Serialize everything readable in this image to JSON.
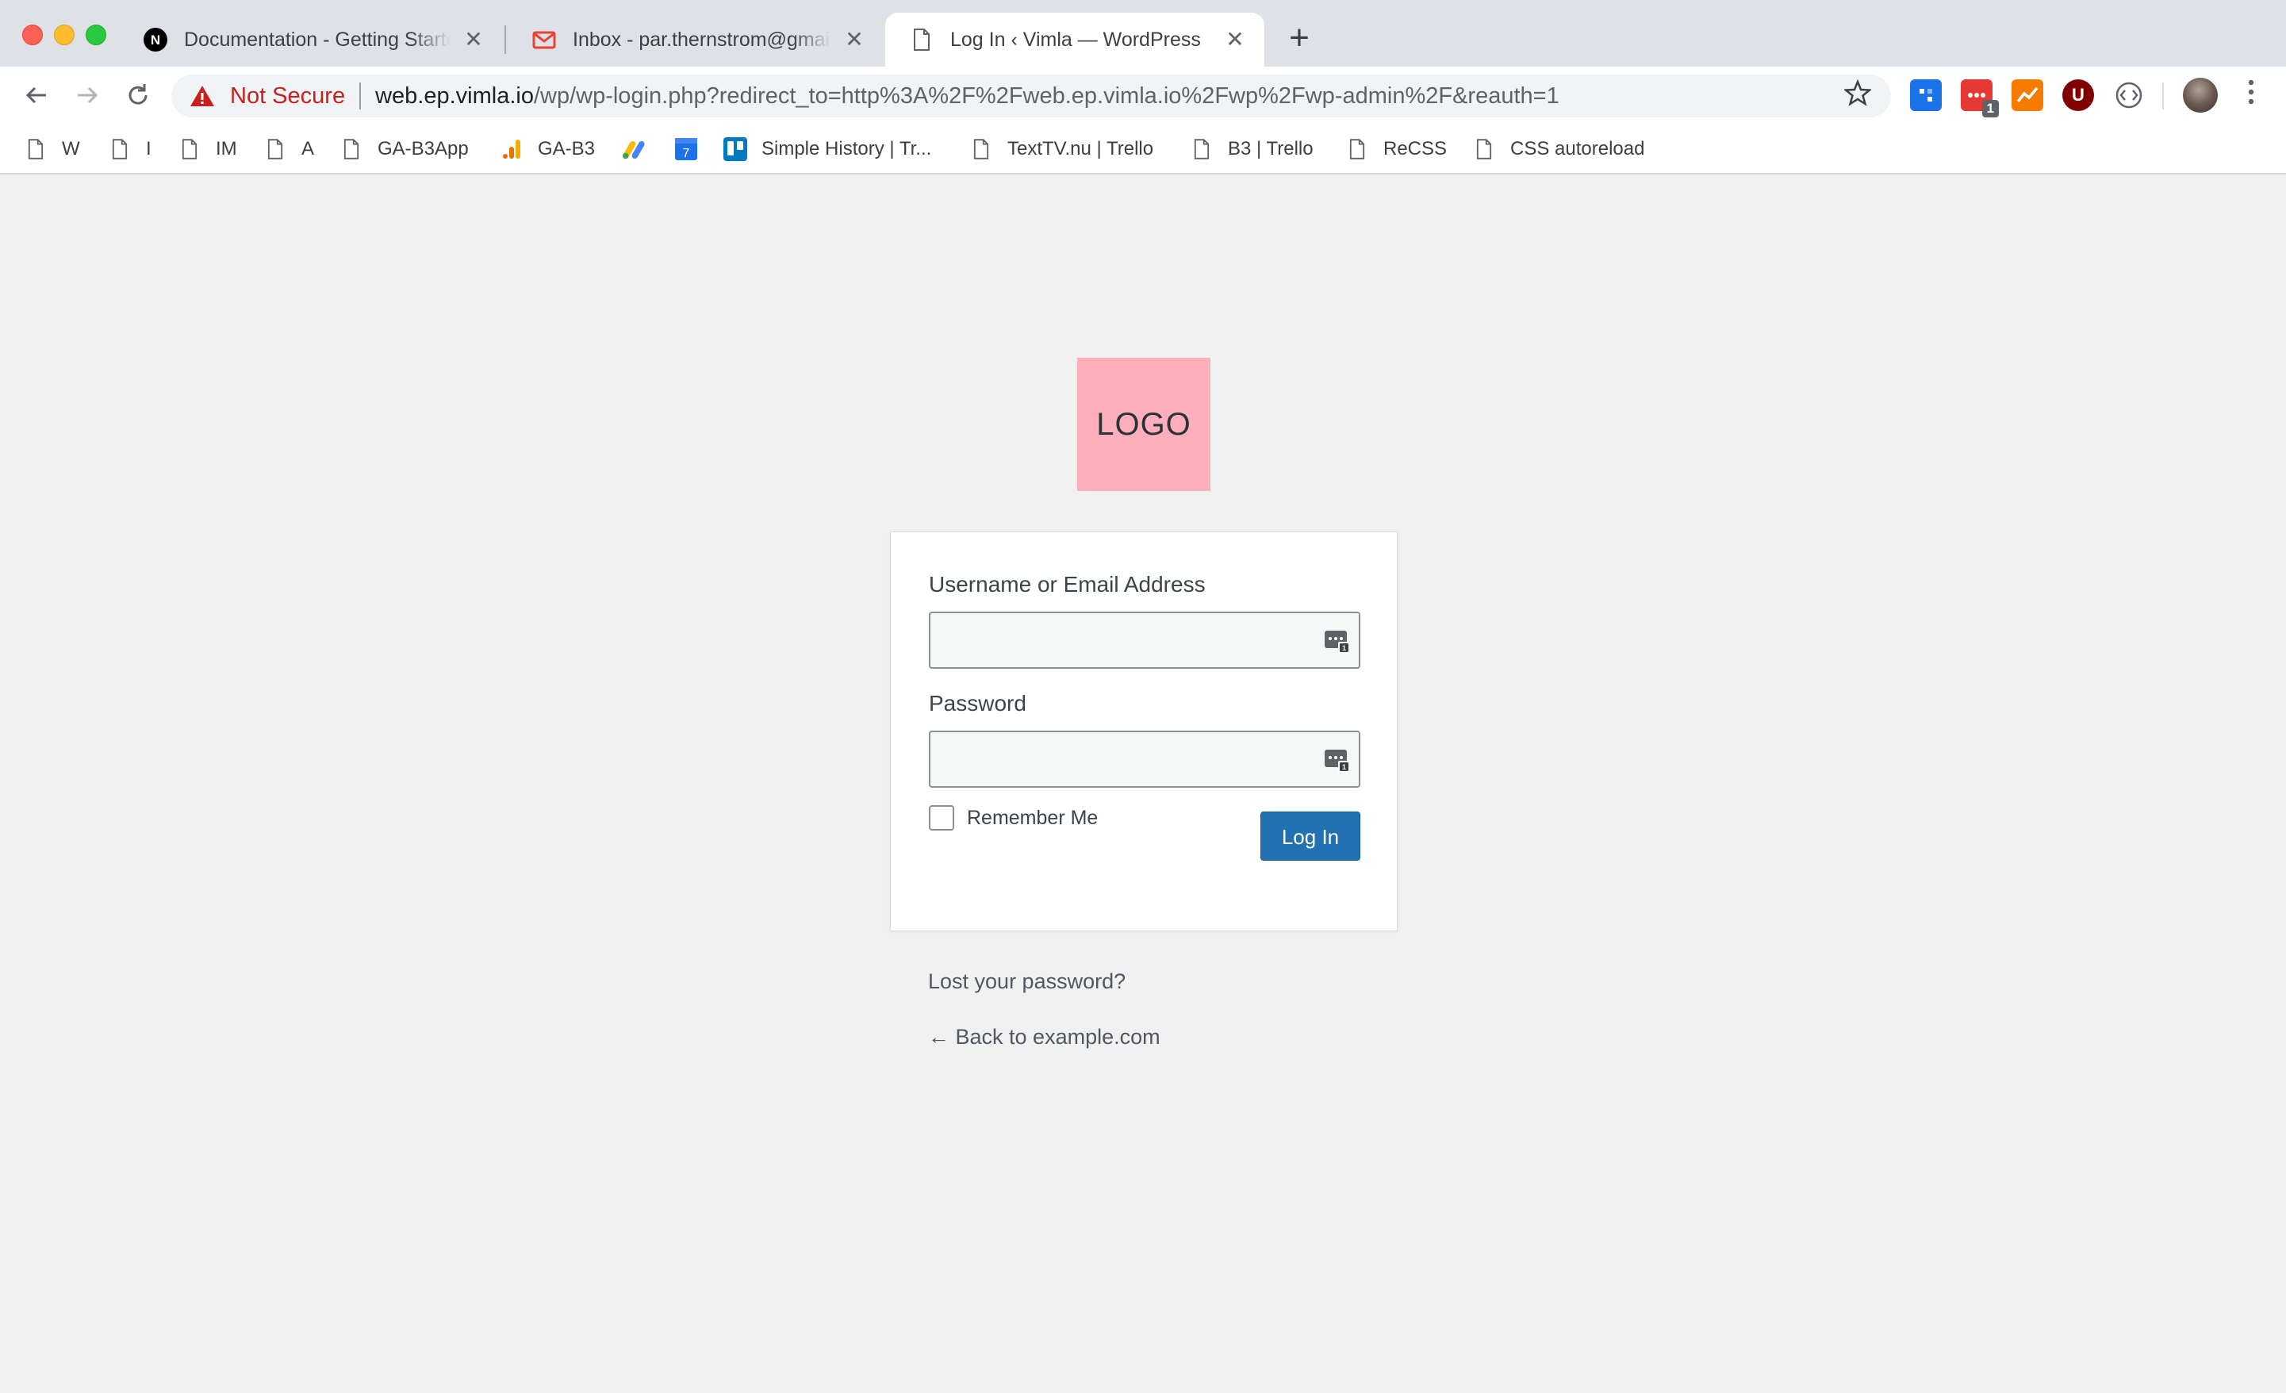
{
  "browser": {
    "tabs": [
      {
        "title": "Documentation - Getting Started",
        "icon": "next-icon",
        "active": false
      },
      {
        "title": "Inbox - par.thernstrom@gmail.com",
        "icon": "gmail-icon",
        "active": false
      },
      {
        "title": "Log In ‹ Vimla — WordPress",
        "icon": "page-icon",
        "active": true
      }
    ],
    "close_glyph": "✕",
    "new_tab_glyph": "+",
    "omnibox": {
      "security_label": "Not Secure",
      "url_host": "web.ep.vimla.io",
      "url_path": "/wp/wp-login.php?redirect_to=http%3A%2F%2Fweb.ep.vimla.io%2Fwp%2Fwp-admin%2F&reauth=1"
    },
    "extensions": [
      {
        "name": "blue-extension-icon",
        "color": "#1a73e8"
      },
      {
        "name": "red-extension-icon",
        "color": "#e53935",
        "badge": "1"
      },
      {
        "name": "chart-extension-icon",
        "color": "#f57c00"
      },
      {
        "name": "ublock-icon",
        "color": "#800000",
        "glyph": "U"
      },
      {
        "name": "code-extension-icon",
        "color": "#5f6368"
      }
    ],
    "bookmarks": [
      {
        "label": "W",
        "icon": "page-icon"
      },
      {
        "label": "I",
        "icon": "page-icon"
      },
      {
        "label": "IM",
        "icon": "page-icon"
      },
      {
        "label": "A",
        "icon": "page-icon"
      },
      {
        "label": "GA-B3App",
        "icon": "page-icon"
      },
      {
        "label": "GA-B3",
        "icon": "analytics-icon"
      },
      {
        "label": "",
        "icon": "google-ads-icon"
      },
      {
        "label": "",
        "icon": "calendar-icon",
        "glyph": "7"
      },
      {
        "label": "Simple History | Tr...",
        "icon": "trello-icon"
      },
      {
        "label": "TextTV.nu | Trello",
        "icon": "page-icon"
      },
      {
        "label": "B3 | Trello",
        "icon": "page-icon"
      },
      {
        "label": "ReCSS",
        "icon": "page-icon"
      },
      {
        "label": "CSS autoreload",
        "icon": "page-icon"
      }
    ]
  },
  "login": {
    "logo_text": "LOGO",
    "username_label": "Username or Email Address",
    "username_value": "",
    "password_label": "Password",
    "password_value": "",
    "remember_label": "Remember Me",
    "remember_checked": false,
    "submit_label": "Log In",
    "lost_password": "Lost your password?",
    "back_link": "← Back to example.com"
  },
  "colors": {
    "page_background": "#f1f1f1",
    "logo_background": "#ffaebc",
    "button_primary": "#2271b1",
    "not_secure": "#c5221f"
  }
}
